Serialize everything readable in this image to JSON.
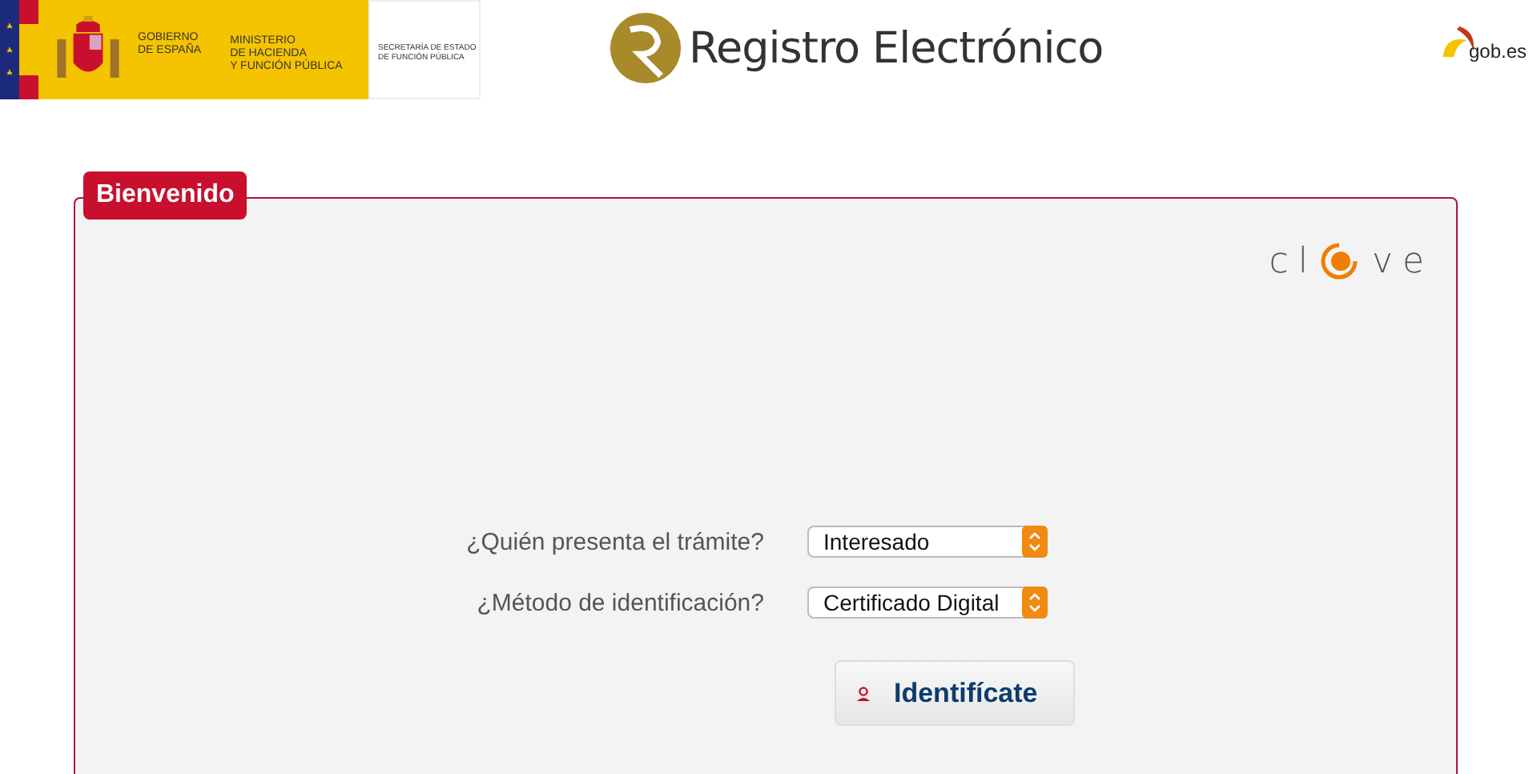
{
  "header": {
    "gov_logo": {
      "government": [
        "GOBIERNO",
        "DE ESPAÑA"
      ],
      "ministry": [
        "MINISTERIO",
        "DE HACIENDA",
        "Y FUNCIÓN PÚBLICA"
      ],
      "secretariat": [
        "SECRETARÍA DE ESTADO",
        "DE FUNCIÓN PÚBLICA"
      ]
    },
    "app_title": "Registro Electrónico",
    "portal_logo": "gob.es"
  },
  "panel": {
    "legend": "Bienvenido",
    "clave_logo": {
      "before": "cl",
      "after": "ve"
    },
    "fields": [
      {
        "label": "¿Quién presenta el trámite?",
        "value": "Interesado"
      },
      {
        "label": "¿Método de identificación?",
        "value": "Certificado Digital"
      }
    ],
    "button": "Identifícate"
  }
}
